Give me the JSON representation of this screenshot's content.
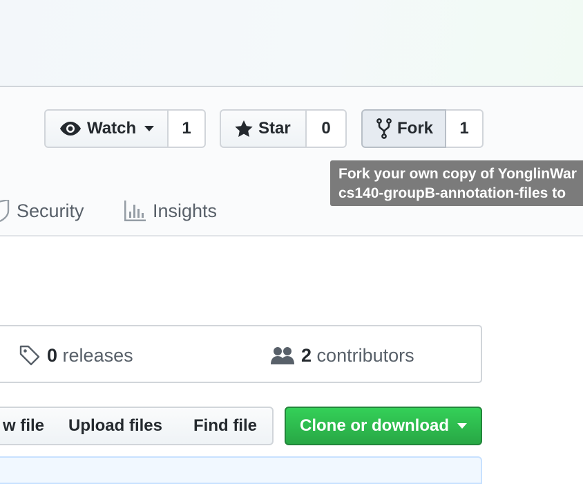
{
  "social": {
    "watch": {
      "label": "Watch",
      "count": "1",
      "icon": "eye-icon"
    },
    "star": {
      "label": "Star",
      "count": "0",
      "icon": "star-icon"
    },
    "fork": {
      "label": "Fork",
      "count": "1",
      "icon": "repo-forked-icon"
    }
  },
  "tooltip": {
    "line1": "Fork your own copy of YonglinWar",
    "line2": "cs140-groupB-annotation-files to"
  },
  "nav": {
    "tabs": [
      {
        "label": "Security",
        "icon": "shield-icon"
      },
      {
        "label": "Insights",
        "icon": "graph-icon"
      }
    ]
  },
  "summary": {
    "releases": {
      "count": "0",
      "label": "releases",
      "icon": "tag-icon"
    },
    "contributors": {
      "count": "2",
      "label": "contributors",
      "icon": "people-icon"
    }
  },
  "file_actions": {
    "new_file": "w file",
    "upload": "Upload files",
    "find": "Find file",
    "clone": "Clone or download"
  },
  "colors": {
    "primary_green": "#28a745",
    "tooltip_bg": "#7b7b7b",
    "text": "#24292e",
    "muted": "#586069"
  }
}
